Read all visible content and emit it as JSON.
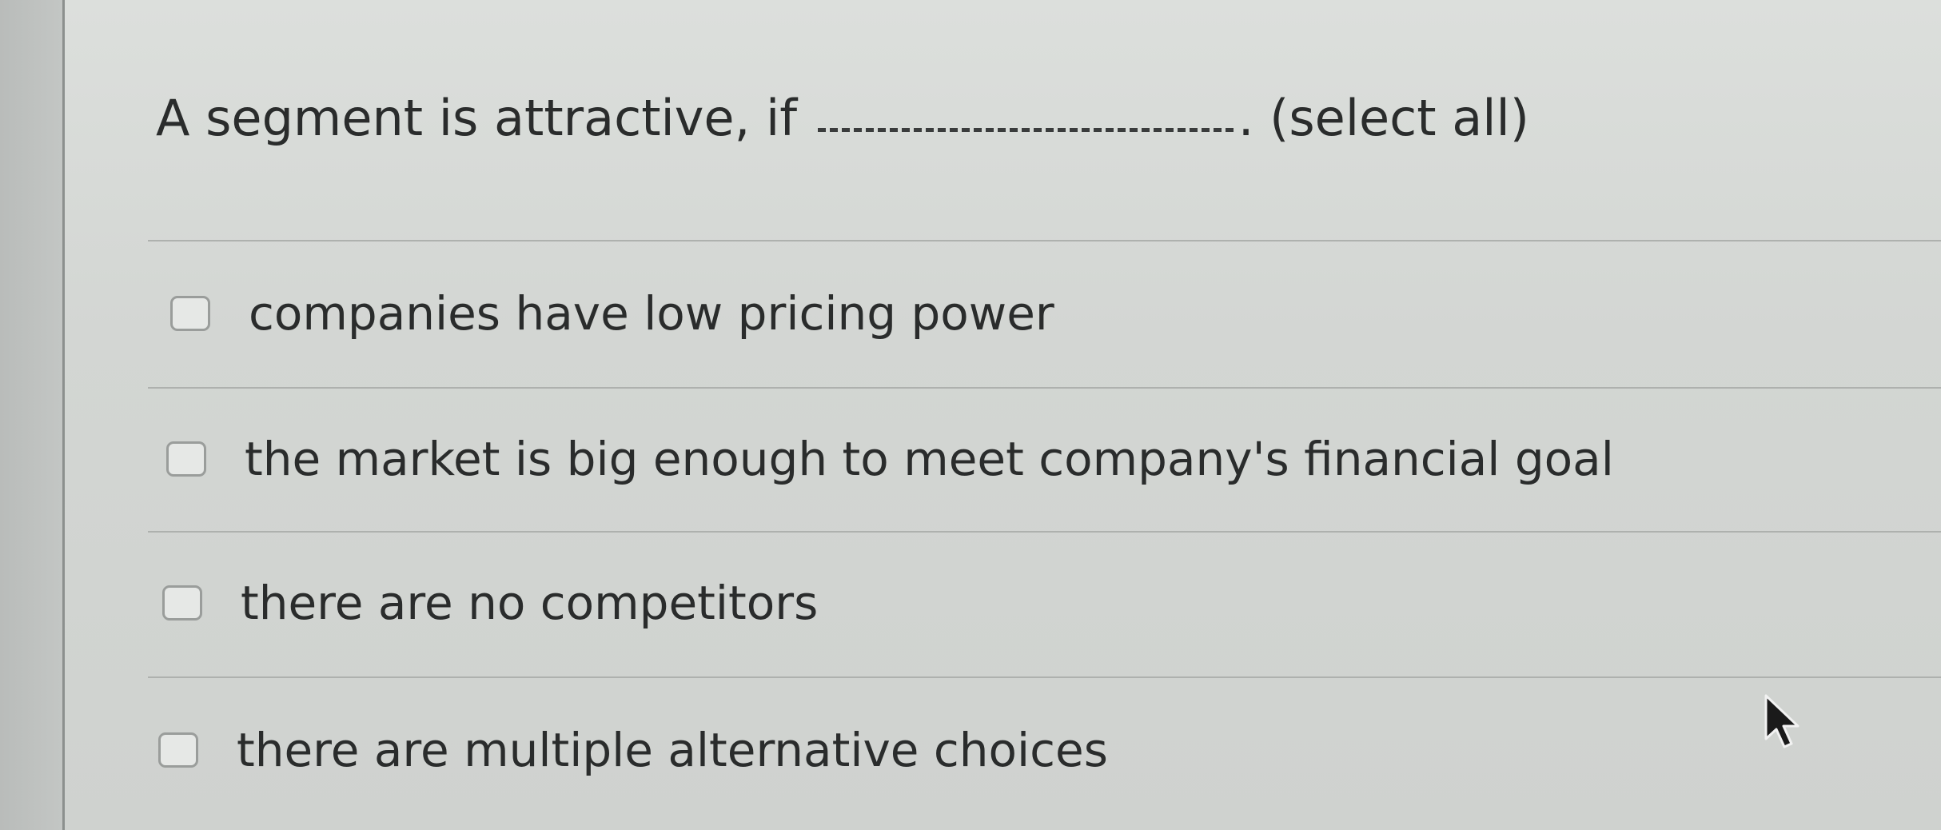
{
  "question": {
    "prefix": "A segment is attractive, if",
    "suffix": ". (select all)"
  },
  "options": [
    {
      "label": "companies have low pricing power",
      "checked": false
    },
    {
      "label": "the market is big enough to meet company's financial goal",
      "checked": false
    },
    {
      "label": "there are no competitors",
      "checked": false
    },
    {
      "label": "there are multiple alternative choices",
      "checked": false
    }
  ],
  "icons": {
    "cursor": "mouse-pointer-icon",
    "checkbox": "checkbox-icon"
  }
}
